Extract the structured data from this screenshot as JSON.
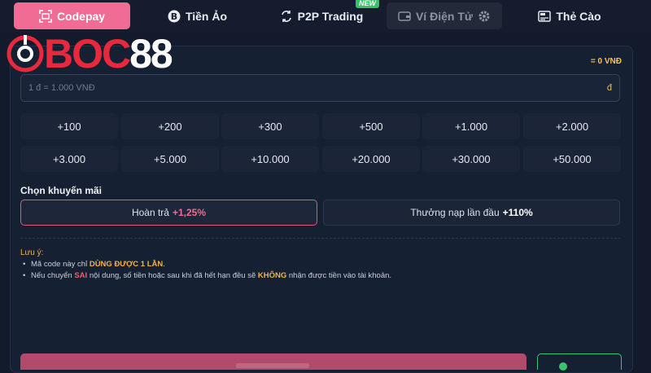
{
  "tabs": [
    {
      "label": "Codepay",
      "icon": "scan-icon",
      "state": "active"
    },
    {
      "label": "Tiền Ảo",
      "icon": "bitcoin-icon",
      "state": "normal"
    },
    {
      "label": "P2P Trading",
      "icon": "exchange-icon",
      "state": "normal",
      "badge": "NEW"
    },
    {
      "label": "Ví Điện Tử",
      "icon": "gear-icon",
      "state": "disabled"
    },
    {
      "label": "Thẻ Cào",
      "icon": "card-icon",
      "state": "normal"
    }
  ],
  "logo": {
    "text_red": "BOC",
    "text_white": "88"
  },
  "amount": {
    "balance": "= 0 VNĐ",
    "placeholder": "1 đ = 1.000 VNĐ",
    "currency": "đ"
  },
  "quick_amounts": [
    "+100",
    "+200",
    "+300",
    "+500",
    "+1.000",
    "+2.000",
    "+3.000",
    "+5.000",
    "+10.000",
    "+20.000",
    "+30.000",
    "+50.000"
  ],
  "promotion": {
    "title": "Chọn khuyến mãi",
    "options": [
      {
        "label": "Hoàn trả",
        "value": "+1,25%",
        "selected": true
      },
      {
        "label": "Thưởng nạp lần đầu",
        "value": "+110%",
        "selected": false
      }
    ]
  },
  "notes": {
    "title": "Lưu ý:",
    "line1_a": "Mã code này chỉ ",
    "line1_hl": "DÙNG ĐƯỢC 1 LẦN",
    "line1_b": ".",
    "line2_a": "Nếu chuyển ",
    "line2_red": "SAI",
    "line2_b": " nội dung, số tiền hoặc sau khi đã hết hạn đều sẽ ",
    "line2_hl": "KHÔNG",
    "line2_c": " nhận được tiền vào tài khoản."
  },
  "colors": {
    "accent": "#f06c94",
    "background": "#121a2b",
    "warning": "#f2b14e",
    "success": "#3bc46c"
  }
}
